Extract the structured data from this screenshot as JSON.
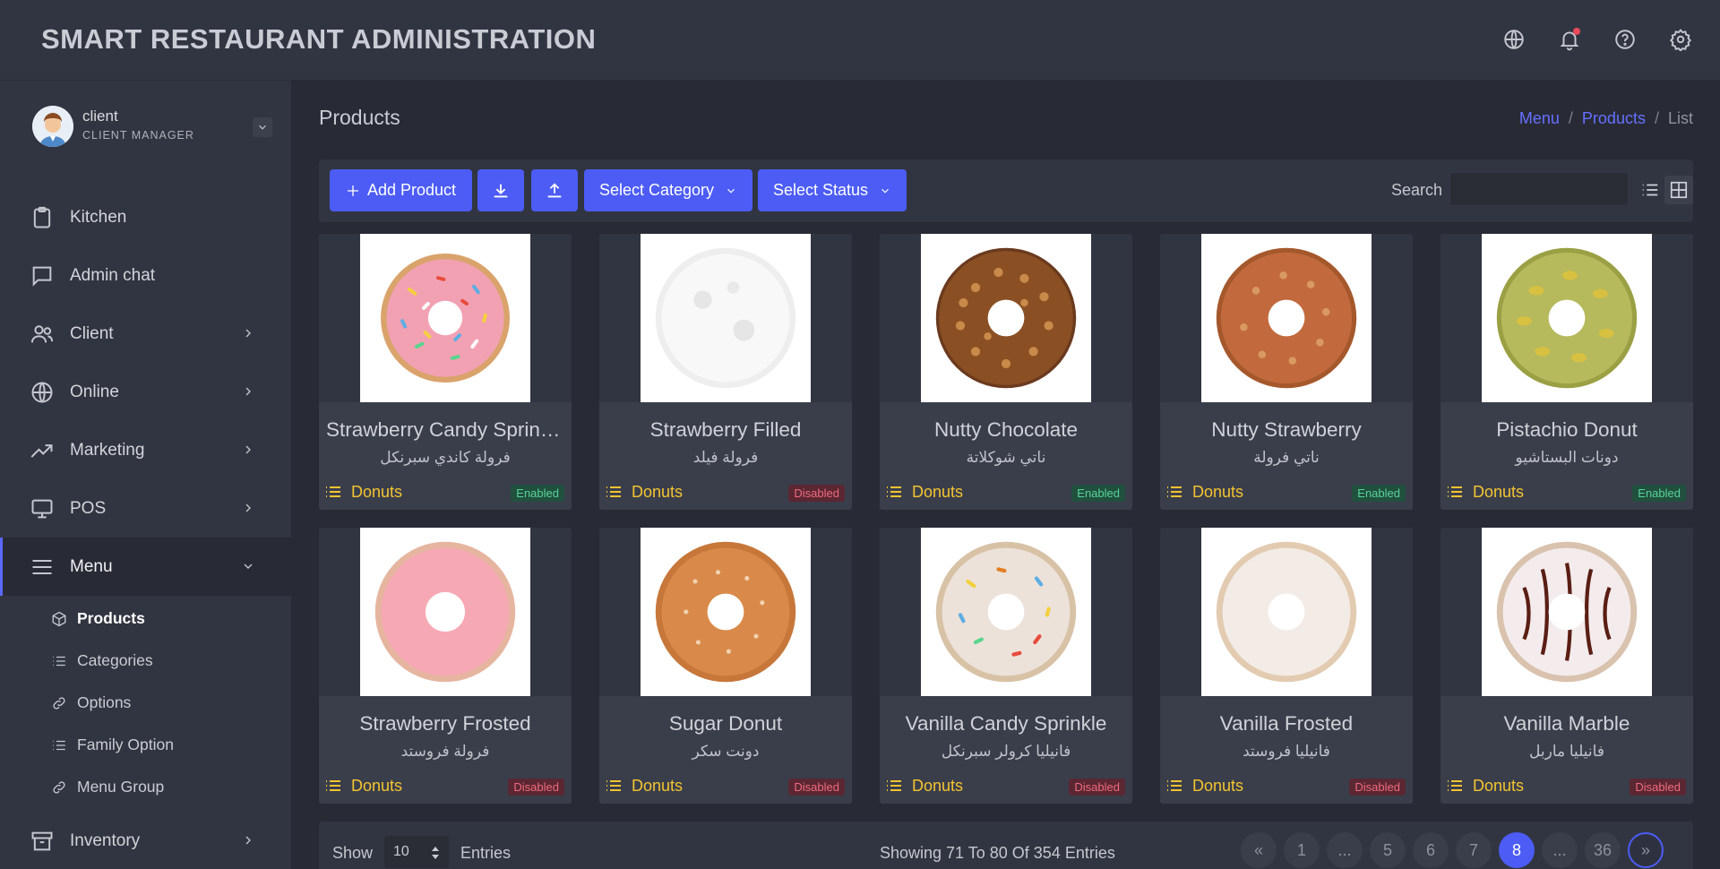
{
  "header": {
    "title": "SMART RESTAURANT ADMINISTRATION",
    "icons": [
      "globe-icon",
      "bell-icon",
      "help-icon",
      "gear-icon"
    ]
  },
  "user": {
    "name": "client",
    "role": "CLIENT MANAGER"
  },
  "sidebar": {
    "items": [
      {
        "label": "Kitchen",
        "icon": "clipboard-icon"
      },
      {
        "label": "Admin chat",
        "icon": "chat-icon"
      },
      {
        "label": "Client",
        "icon": "users-icon"
      },
      {
        "label": "Online",
        "icon": "globe-icon"
      },
      {
        "label": "Marketing",
        "icon": "trending-icon"
      },
      {
        "label": "POS",
        "icon": "monitor-icon"
      },
      {
        "label": "Menu",
        "icon": "menu-icon"
      },
      {
        "label": "Inventory",
        "icon": "archive-icon"
      }
    ],
    "menu_subitems": [
      {
        "label": "Products",
        "icon": "cube-icon"
      },
      {
        "label": "Categories",
        "icon": "list-icon"
      },
      {
        "label": "Options",
        "icon": "link-icon"
      },
      {
        "label": "Family Option",
        "icon": "list-icon"
      },
      {
        "label": "Menu Group",
        "icon": "link-icon"
      }
    ]
  },
  "page": {
    "title": "Products",
    "breadcrumb": [
      "Menu",
      "Products",
      "List"
    ]
  },
  "toolbar": {
    "add_label": "Add Product",
    "category_label": "Select Category",
    "status_label": "Select Status",
    "search_label": "Search",
    "search_value": "",
    "accent": "#4c5cf5"
  },
  "products": [
    {
      "name": "Strawberry Candy Sprinkle",
      "name_ar": "فرولة كاندي سبرنكل",
      "category": "Donuts",
      "status": "Enabled"
    },
    {
      "name": "Strawberry Filled",
      "name_ar": "فرولة فيلد",
      "category": "Donuts",
      "status": "Disabled"
    },
    {
      "name": "Nutty Chocolate",
      "name_ar": "ناتي شوكلاتة",
      "category": "Donuts",
      "status": "Enabled"
    },
    {
      "name": "Nutty Strawberry",
      "name_ar": "ناتي فرولة",
      "category": "Donuts",
      "status": "Enabled"
    },
    {
      "name": "Pistachio Donut",
      "name_ar": "دونات البستاشيو",
      "category": "Donuts",
      "status": "Enabled"
    },
    {
      "name": "Strawberry Frosted",
      "name_ar": "فرولة فروستد",
      "category": "Donuts",
      "status": "Disabled"
    },
    {
      "name": "Sugar Donut",
      "name_ar": "دونت سكر",
      "category": "Donuts",
      "status": "Disabled"
    },
    {
      "name": "Vanilla Candy Sprinkle",
      "name_ar": "فانيليا كرولر سبرنكل",
      "category": "Donuts",
      "status": "Disabled"
    },
    {
      "name": "Vanilla Frosted",
      "name_ar": "فانيليا فروستد",
      "category": "Donuts",
      "status": "Disabled"
    },
    {
      "name": "Vanilla Marble",
      "name_ar": "فانيليا ماربل",
      "category": "Donuts",
      "status": "Disabled"
    }
  ],
  "footer": {
    "show_label": "Show",
    "entries_value": "10",
    "entries_label": "Entries",
    "showing_text": "Showing 71 To 80 Of 354 Entries",
    "pages": [
      "«",
      "1",
      "...",
      "5",
      "6",
      "7",
      "8",
      "...",
      "36",
      "»"
    ],
    "current_page": "8"
  }
}
